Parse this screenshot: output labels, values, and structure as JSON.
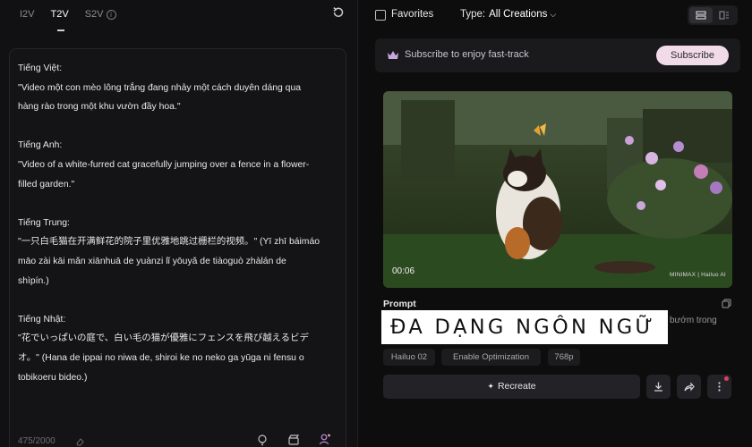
{
  "tabs": [
    {
      "label": "I2V"
    },
    {
      "label": "T2V"
    },
    {
      "label": "S2V"
    }
  ],
  "prompt": {
    "lines": [
      "Tiếng Việt:",
      "\"Video một con mèo lông trắng đang nhảy một cách duyên dáng qua",
      "hàng rào trong một khu vườn đầy hoa.\"",
      "",
      "Tiếng Anh:",
      "\"Video of a white-furred cat gracefully jumping over a fence in a flower-",
      "filled garden.\"",
      "",
      "Tiếng Trung:",
      "\"一只白毛猫在开满鲜花的院子里优雅地跳过栅栏的视频。\" (Yī zhī báimáo",
      "māo zài kāi mǎn xiānhuā de yuànzi lǐ yōuyǎ de tiàoguò zhàlán de",
      "shìpín.)",
      "",
      "Tiếng Nhật:",
      "\"花でいっぱいの庭で、白い毛の猫が優雅にフェンスを飛び越えるビデ",
      "オ。\" (Hana de ippai no niwa de, shiroi ke no neko ga yūga ni fensu o",
      "tobikoeru bideo.)"
    ],
    "counter": "475/2000"
  },
  "toolbar": {
    "favorites_label": "Favorites",
    "type_label": "Type:",
    "type_value": "All Creations"
  },
  "subscribe": {
    "text": "Subscribe to enjoy fast-track",
    "button_label": "Subscribe",
    "button_color": "#f2dbe8"
  },
  "video": {
    "time": "00:06",
    "watermark": "MINIMAX | Hailuo AI"
  },
  "card": {
    "prompt_label": "Prompt",
    "prompt_visible_left": "V",
    "prompt_visible_right": "bướm trong",
    "overlay_text": "ĐA DẠNG NGÔN NGỮ",
    "tags": [
      "Hailuo 02",
      "Enable Optimization",
      "768p"
    ],
    "recreate_label": "Recreate"
  },
  "colors": {
    "background": "#0f0f10",
    "panel": "#141416",
    "notification_dot": "#e0405a"
  },
  "icons": [
    "info-icon",
    "reset-icon",
    "eraser-icon",
    "lightbulb-icon",
    "clapper-icon",
    "character-icon",
    "crown-icon",
    "list-view-icon",
    "grid-view-icon",
    "copy-icon",
    "sparkle-icon",
    "download-icon",
    "share-icon",
    "more-icon"
  ]
}
